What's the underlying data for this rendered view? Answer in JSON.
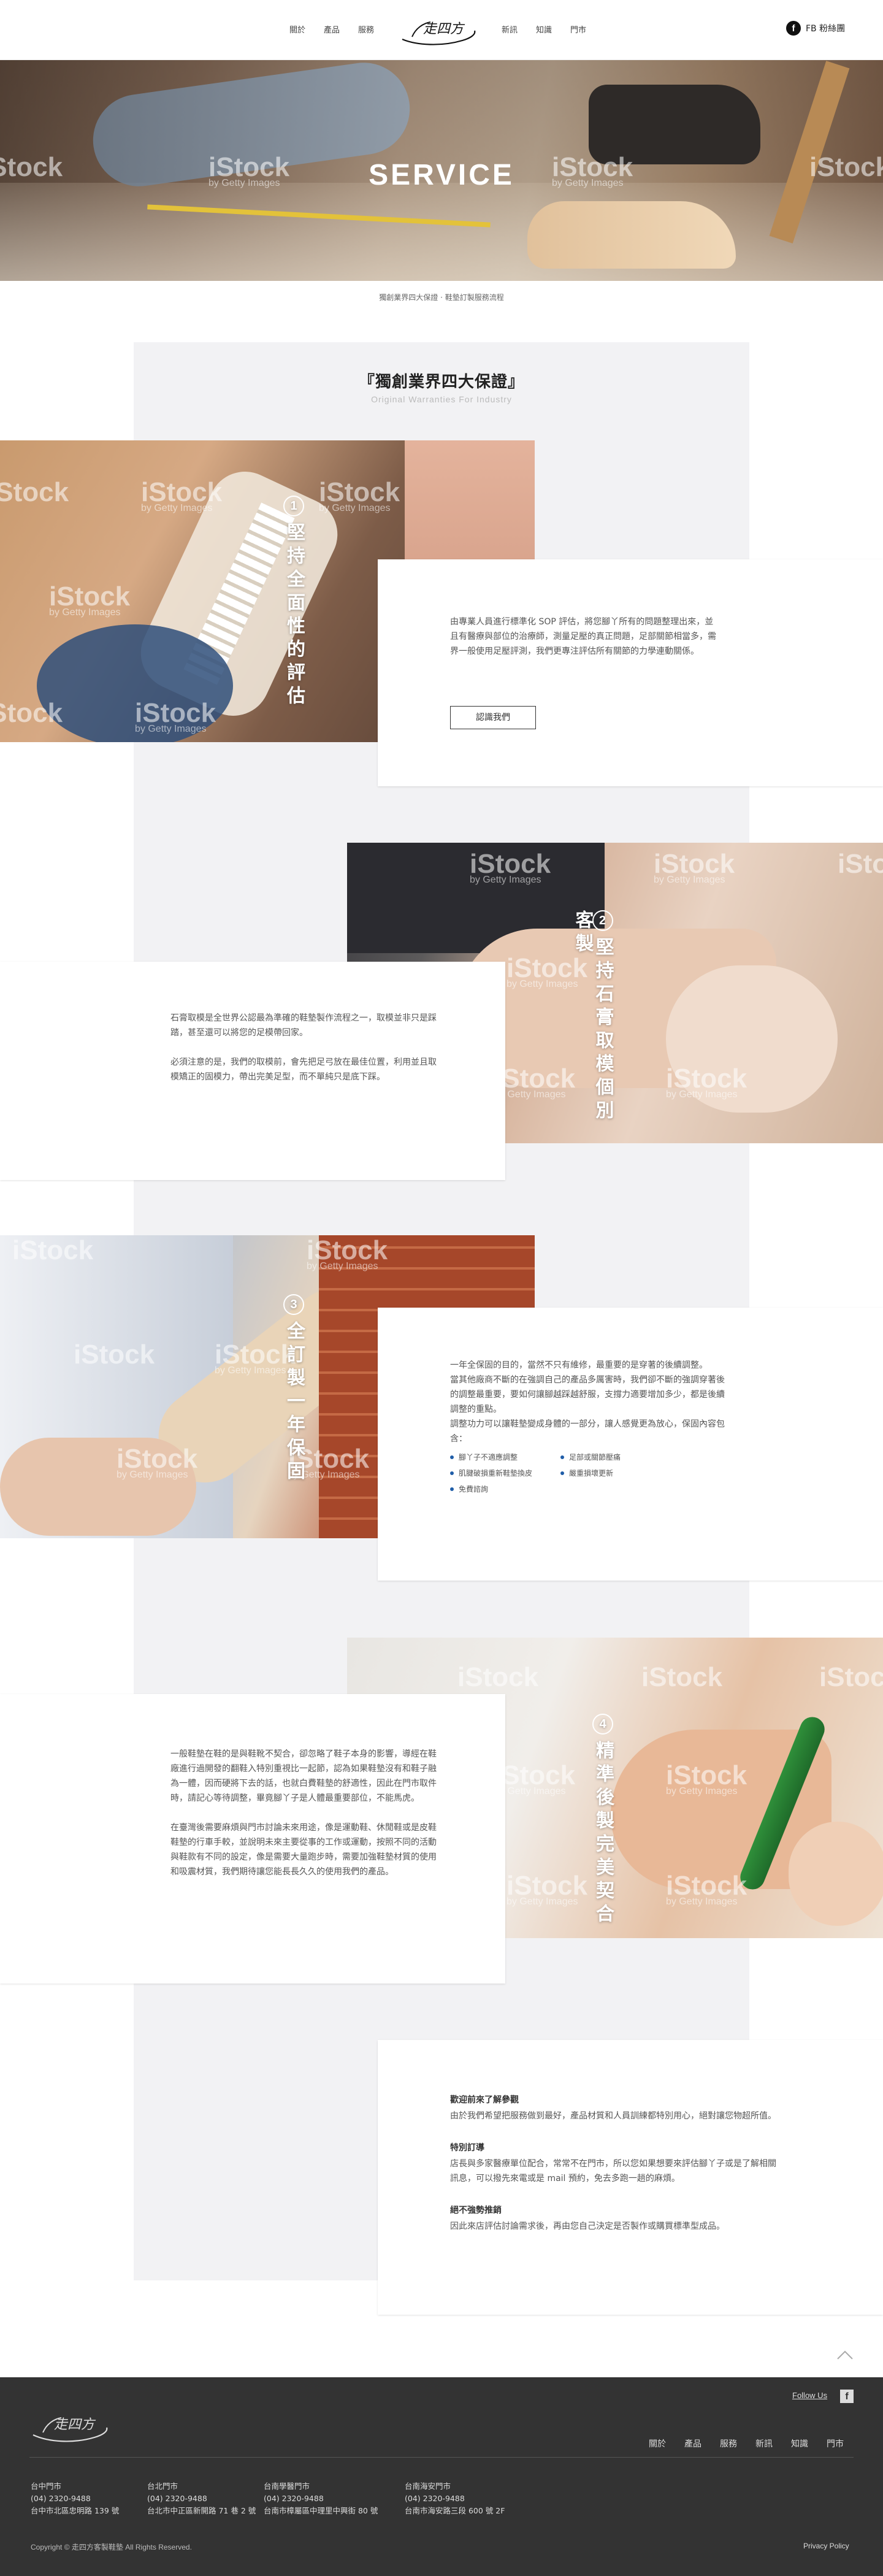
{
  "header": {
    "nav_left": [
      "關於",
      "產品",
      "服務"
    ],
    "nav_right": [
      "新訊",
      "知識",
      "門市"
    ],
    "logo_alt": "走四方",
    "fb_label": "FB 粉絲團"
  },
  "hero": {
    "title": "SERVICE",
    "watermark_brand": "iStock",
    "watermark_sub": "by Getty Images"
  },
  "breadcrumb": "獨創業界四大保證 · 鞋墊訂製服務流程",
  "section": {
    "title": "『獨創業界四大保證』",
    "subtitle": "Original Warranties For Industry"
  },
  "guarantees": [
    {
      "number": "1",
      "title": "堅持全面性的評估",
      "paragraphs": [
        "由專業人員進行標準化 SOP 評估，將您腳丫所有的問題整理出來，並且有醫療與部位的治療師，測量足壓的真正問題，足部關節相當多，需界一般使用足壓評測，我們更專注評估所有關節的力學連動關係。"
      ],
      "button": "認識我們"
    },
    {
      "number": "2",
      "title": "堅持石膏取模個別客製",
      "paragraphs": [
        "石膏取模是全世界公認最為準確的鞋墊製作流程之一，取模並非只是踩踏，甚至還可以將您的足模帶回家。",
        "必須注意的是，我們的取模前，會先把足弓放在最佳位置，利用並且取模矯正的固模力，帶出完美足型，而不單純只是底下踩。"
      ]
    },
    {
      "number": "3",
      "title": "全訂製一年保固",
      "intro": [
        "一年全保固的目的，當然不只有維修，最重要的是穿著的後續調整。",
        "當其他廠商不斷的在強調自己的產品多厲害時，我們卻不斷的強調穿著後的調整最重要，要如何讓腳越踩越舒服，支撐力適要增加多少，都是後續調整的重點。",
        "調整功力可以讓鞋墊變成身體的一部分，讓人感覺更為放心，保固內容包含："
      ],
      "bullets": [
        "腳丫子不適應調整",
        "足部或關節壓痛",
        "肌腱破損重新鞋墊換皮",
        "嚴重損壞更新",
        "免費諮詢"
      ]
    },
    {
      "number": "4",
      "title": "精準後製完美契合",
      "paragraphs": [
        "一般鞋墊在鞋的是與鞋靴不契合，卻忽略了鞋子本身的影響，導經在鞋廠進行過開發的翻鞋入特別重視比一起節，認為如果鞋墊沒有和鞋子融為一體，因而硬將下去的話，也就白費鞋墊的舒適性，因此在門市取件時，請記心等待調整，畢竟腳丫子是人體最重要部位，不能馬虎。",
        "在臺灣後需要麻煩與門市討論未來用途，像是運動鞋、休閒鞋或是皮鞋鞋墊的行車手較，並說明未來主要從事的工作或運動，按照不同的活動與鞋款有不同的設定，像是需要大量跑步時，需要加強鞋墊材質的使用和吸震材質，我們期待讓您能長長久久的使用我們的產品。"
      ]
    }
  ],
  "notes": [
    {
      "title": "歡迎前來了解參觀",
      "body": "由於我們希望把服務做到最好，產品材質和人員訓練都特別用心，絕對讓您物超所值。"
    },
    {
      "title": "特別訂導",
      "body": "店長與多家醫療單位配合，常常不在門市，所以您如果想要來評估腳丫子或是了解相關訊息，可以撥先來電或是 mail 預約，免去多跑一趟的麻煩。"
    },
    {
      "title": "絕不強勢推銷",
      "body": "因此來店評估討論需求後，再由您自己決定是否製作或購買標準型成品。"
    }
  ],
  "footer": {
    "follow": "Follow Us",
    "nav": [
      "關於",
      "產品",
      "服務",
      "新訊",
      "知識",
      "門市"
    ],
    "stores": [
      {
        "name": "台中門市",
        "phone": "(04) 2320-9488",
        "address": "台中市北區忠明路 139 號"
      },
      {
        "name": "台北門市",
        "phone": "(04) 2320-9488",
        "address": "台北市中正區新開路 71 巷 2 號"
      },
      {
        "name": "台南學醫門市",
        "phone": "(04) 2320-9488",
        "address": "台南市樟屬區中理里中興街 80 號"
      },
      {
        "name": "台南海安門市",
        "phone": "(04) 2320-9488",
        "address": "台南市海安路三段 600 號 2F"
      }
    ],
    "copyright": "Copyright © 走四方客製鞋墊 All Rights Reserved.",
    "privacy": "Privacy Policy"
  }
}
